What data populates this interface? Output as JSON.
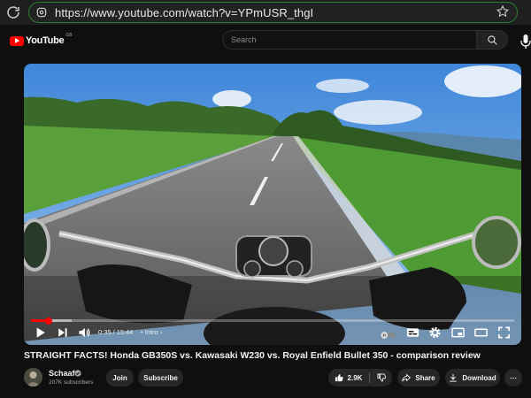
{
  "browser": {
    "url": "https://www.youtube.com/watch?v=YPmUSR_thgI"
  },
  "header": {
    "logo_text": "YouTube",
    "country_code": "GB",
    "search_placeholder": "Search"
  },
  "player": {
    "current_time": "0:35",
    "separator": "/",
    "duration": "15:44",
    "chapter": "Intro",
    "chapter_chevron": "›",
    "progress_fraction": 0.037,
    "buffered_fraction": 0.085
  },
  "video": {
    "title": "STRAIGHT FACTS! Honda GB350S vs. Kawasaki W230 vs. Royal Enfield Bullet 350 - comparison review"
  },
  "channel": {
    "name": "Schaaf",
    "subscribers": "207K subscribers",
    "join_label": "Join",
    "subscribe_label": "Subscribe"
  },
  "actions": {
    "likes": "2.9K",
    "share_label": "Share",
    "download_label": "Download",
    "more_label": "⋯"
  },
  "colors": {
    "accent": "#ff0000",
    "background": "#0f0f0f",
    "button_bg": "#272727",
    "omnibox_border": "#2e7d32"
  }
}
